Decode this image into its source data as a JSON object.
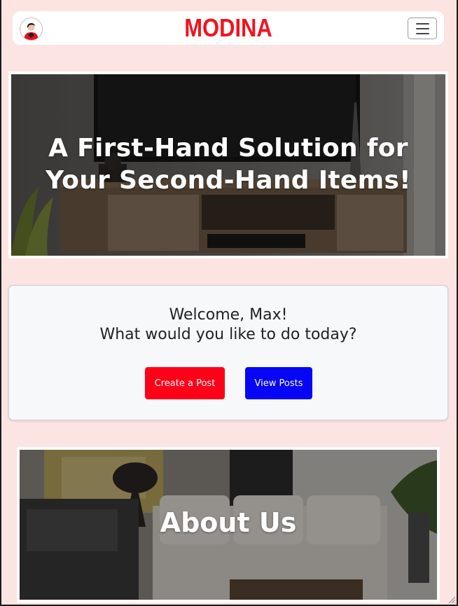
{
  "navbar": {
    "brand": "MODINA",
    "avatar_icon": "user-avatar-icon",
    "menu_icon": "hamburger-menu-icon",
    "brand_color": "#f0141e"
  },
  "hero": {
    "title_line1": "A First-Hand Solution for",
    "title_line2": "Your Second-Hand Items!"
  },
  "welcome": {
    "greeting": "Welcome, Max!",
    "question": "What would you like to do today?",
    "create_label": "Create a Post",
    "view_label": "View Posts",
    "create_color": "#ff0018",
    "view_color": "#0606f4"
  },
  "about": {
    "title": "About Us"
  },
  "colors": {
    "page_background": "#fbe4e2"
  }
}
